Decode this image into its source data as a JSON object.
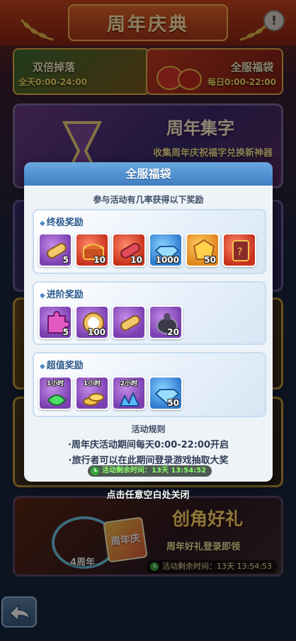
{
  "header": {
    "title": "周年庆典",
    "info_label": "!"
  },
  "cards": {
    "double_drop": {
      "title": "双倍掉落",
      "time": "全天0:00-24:00"
    },
    "server_bag": {
      "title": "全服福袋",
      "time": "每日0:00-22:00"
    }
  },
  "events": {
    "jizi": {
      "title": "周年集字",
      "subtitle": "收集周年庆祝福字兑换新神器"
    },
    "role": {
      "title": "创角好礼",
      "subtitle": "周年好礼登录即领",
      "timer": "活动剩余时间：13天 13:54:53",
      "badge_text": "4周年",
      "card_text": "周年庆"
    }
  },
  "close_hint": "点击任意空白处关闭",
  "modal": {
    "title": "全服福袋",
    "subtitle": "参与活动有几率获得以下奖励",
    "sections": [
      {
        "title": "终极奖励",
        "items": [
          {
            "icon": "scroll-icon",
            "color": "purple",
            "count": "5"
          },
          {
            "icon": "treasure-chest-icon",
            "color": "red",
            "count": "10"
          },
          {
            "icon": "red-scroll-icon",
            "color": "red",
            "count": "10"
          },
          {
            "icon": "blue-diamond-icon",
            "color": "blue",
            "count": "1000"
          },
          {
            "icon": "gold-gem-icon",
            "color": "orange",
            "count": "50"
          },
          {
            "icon": "skill-card-icon",
            "color": "red",
            "count": ""
          }
        ]
      },
      {
        "title": "进阶奖励",
        "items": [
          {
            "icon": "puzzle-piece-icon",
            "color": "purple",
            "count": "5"
          },
          {
            "icon": "silver-coin-icon",
            "color": "purple",
            "count": "100"
          },
          {
            "icon": "scroll-icon",
            "color": "purple",
            "count": ""
          },
          {
            "icon": "money-bag-icon",
            "color": "purple",
            "count": "20"
          }
        ]
      },
      {
        "title": "超值奖励",
        "items": [
          {
            "icon": "green-boost-icon",
            "color": "purple",
            "count": "",
            "duration": "1小时"
          },
          {
            "icon": "coin-stack-icon",
            "color": "purple",
            "count": "",
            "duration": "1小时"
          },
          {
            "icon": "crystal-pile-icon",
            "color": "purple",
            "count": "",
            "duration": "2小时"
          },
          {
            "icon": "blue-diamond-icon",
            "color": "blue",
            "count": "50"
          }
        ]
      }
    ],
    "rules_title": "活动规则",
    "rules": [
      "·周年庆活动期间每天0:00-22:00开启",
      "·旅行者可以在此期间登录游戏抽取大奖"
    ],
    "timer": "活动剩余时间：13天 13:54:52"
  },
  "colors": {
    "accent": "#3f7ec2",
    "timer_green": "#8cff6a",
    "count_gold": "#ffe36b"
  }
}
